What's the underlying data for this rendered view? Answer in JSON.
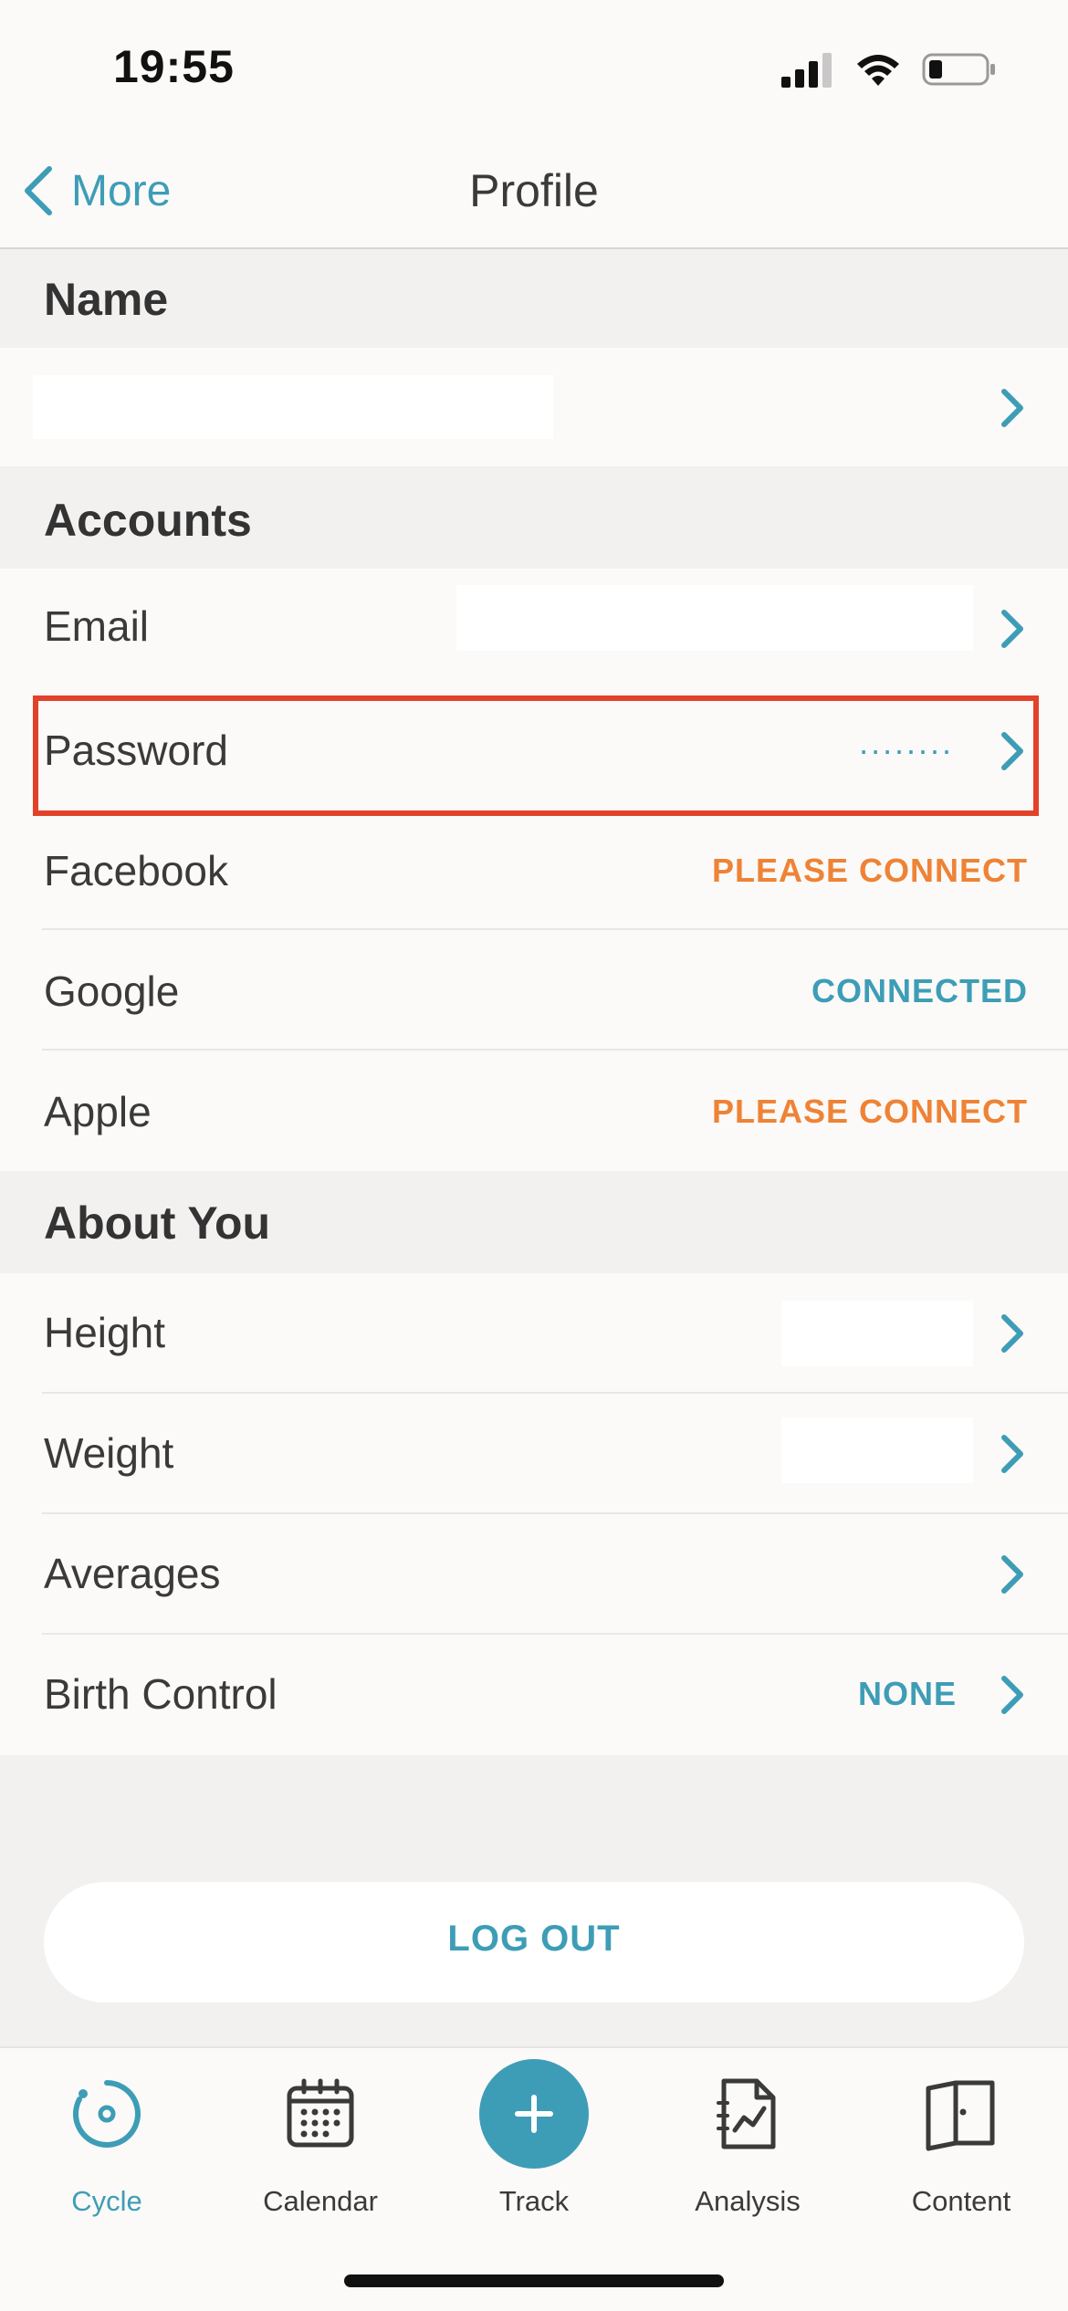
{
  "status_bar": {
    "time": "19:55"
  },
  "nav": {
    "back_label": "More",
    "title": "Profile"
  },
  "sections": {
    "name": {
      "title": "Name"
    },
    "accounts": {
      "title": "Accounts",
      "email_label": "Email",
      "password_label": "Password",
      "password_value": "········",
      "facebook_label": "Facebook",
      "facebook_status": "PLEASE CONNECT",
      "google_label": "Google",
      "google_status": "CONNECTED",
      "apple_label": "Apple",
      "apple_status": "PLEASE CONNECT"
    },
    "about": {
      "title": "About You",
      "height_label": "Height",
      "weight_label": "Weight",
      "averages_label": "Averages",
      "birth_control_label": "Birth Control",
      "birth_control_value": "NONE"
    }
  },
  "logout_label": "LOG OUT",
  "tabs": [
    {
      "label": "Cycle",
      "icon": "cycle-icon",
      "active": true
    },
    {
      "label": "Calendar",
      "icon": "calendar-icon",
      "active": false
    },
    {
      "label": "Track",
      "icon": "plus-icon",
      "active": false
    },
    {
      "label": "Analysis",
      "icon": "analysis-icon",
      "active": false
    },
    {
      "label": "Content",
      "icon": "book-icon",
      "active": false
    }
  ],
  "colors": {
    "accent": "#3e9db6",
    "warning": "#ee8336",
    "highlight": "#e2422a",
    "background": "#f2f1f0",
    "row": "#fbfaf8"
  }
}
